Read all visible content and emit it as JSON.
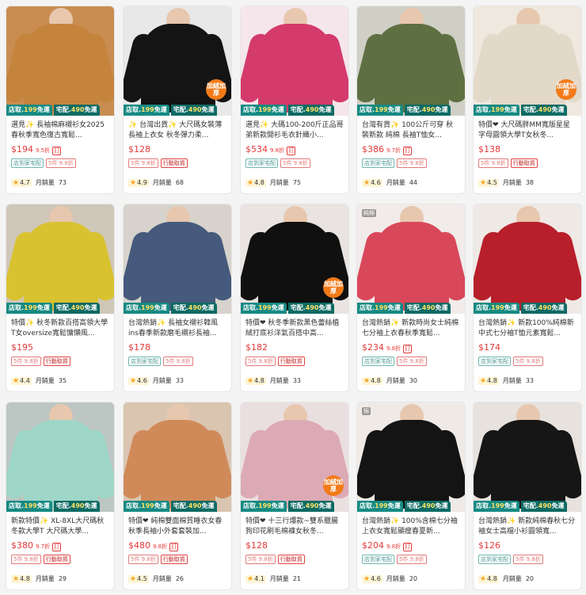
{
  "ribbon": {
    "store_prefix": "店取.",
    "store_price": "199",
    "store_suffix": "免運",
    "home_prefix": "宅配.",
    "home_price": "490",
    "home_suffix": "免運"
  },
  "sold_label": "月銷量",
  "products": [
    {
      "title": "選見✨ 長袖棉麻襯衫女2025春秋季寬色復古寬鬆...",
      "price": "$194",
      "disc": "9.5折",
      "tix": "訂",
      "badges": [
        "店到家宅配",
        "5件 9.8折"
      ],
      "rating": "4.7",
      "sold": "73",
      "bg": "#c98d52",
      "cloth": "#c4843c",
      "corner": "",
      "warm": ""
    },
    {
      "title": "✨ 台灣出貨✨ 大尺碼女裝薄長袖上衣女 秋冬彈力柔...",
      "price": "$128",
      "disc": "",
      "tix": "",
      "badges": [
        "5件 9.8折",
        "行動取貨"
      ],
      "rating": "4.9",
      "sold": "68",
      "bg": "#e8e8e8",
      "cloth": "#141414",
      "corner": "",
      "warm": "加絨加厚"
    },
    {
      "title": "選見✨ 大碼100-200斤正品哥弟新款開衫毛衣針織小...",
      "price": "$534",
      "disc": "9.8折",
      "tix": "訂",
      "badges": [
        "店到家宅配",
        "5件 9.8折"
      ],
      "rating": "4.8",
      "sold": "75",
      "bg": "#f4e6ea",
      "cloth": "#d53a6c",
      "corner": "",
      "warm": ""
    },
    {
      "title": "台灣有貨✨ 100公斤可穿 秋裝新款 純棉 長袖T恤女...",
      "price": "$386",
      "disc": "9.7折",
      "tix": "訂",
      "badges": [
        "店到家宅配",
        "5件 9.8折"
      ],
      "rating": "4.6",
      "sold": "44",
      "bg": "#cfcfc5",
      "cloth": "#5e7042",
      "corner": "",
      "warm": ""
    },
    {
      "title": "特價❤ 大尺碼胖MM寬版星星字母圓領大學T女秋冬...",
      "price": "$138",
      "disc": "",
      "tix": "",
      "badges": [
        "5件 9.8折",
        "行動取貨"
      ],
      "rating": "4.5",
      "sold": "38",
      "bg": "#efe8df",
      "cloth": "#e3d9c9",
      "corner": "",
      "warm": "加絨加厚"
    },
    {
      "title": "特價✨ 秋冬新款百搭高領大學T女oversize寬鬆慵懶風...",
      "price": "$195",
      "disc": "",
      "tix": "",
      "badges": [
        "5件 9.8折",
        "行動取貨"
      ],
      "rating": "4.4",
      "sold": "35",
      "bg": "#cfc7b8",
      "cloth": "#d9c230",
      "corner": "",
      "warm": ""
    },
    {
      "title": "台灣熱銷✨ 長袖女襯衫韓風ins春季新款磨毛襯衫長袖...",
      "price": "$178",
      "disc": "",
      "tix": "",
      "badges": [
        "店到家宅配",
        "5件 9.8折"
      ],
      "rating": "4.6",
      "sold": "33",
      "bg": "#d7d3cc",
      "cloth": "#455a7c",
      "corner": "",
      "warm": ""
    },
    {
      "title": "特價❤ 秋冬季新款黑色蕾絲植絨打底衫洋氣百搭中高...",
      "price": "$182",
      "disc": "",
      "tix": "",
      "badges": [
        "5件 9.8折",
        "行動取貨"
      ],
      "rating": "4.8",
      "sold": "33",
      "bg": "#e9e4e1",
      "cloth": "#101010",
      "corner": "",
      "warm": "加絨加厚"
    },
    {
      "title": "台灣熱銷✨ 新款時尚女士純棉七分袖上衣春秋季寬鬆...",
      "price": "$234",
      "disc": "9.8折",
      "tix": "訂",
      "badges": [
        "店到家宅配",
        "5件 9.8折"
      ],
      "rating": "4.8",
      "sold": "30",
      "bg": "#f1ecea",
      "cloth": "#d9485a",
      "corner": "純棉",
      "warm": ""
    },
    {
      "title": "台灣熱銷✨ 新款100%純棉新中式七分袖T恤元素寬鬆...",
      "price": "$174",
      "disc": "",
      "tix": "",
      "badges": [
        "店到家宅配",
        "5件 9.8折"
      ],
      "rating": "4.8",
      "sold": "33",
      "bg": "#efe9e6",
      "cloth": "#b81f2b",
      "corner": "",
      "warm": ""
    },
    {
      "title": "新款特價✨ XL-8XL大尺碼秋冬款大學T 大尺碼大學...",
      "price": "$380",
      "disc": "9.7折",
      "tix": "訂",
      "badges": [
        "5件 9.8折",
        "行動取貨"
      ],
      "rating": "4.8",
      "sold": "29",
      "bg": "#bcc6c2",
      "cloth": "#9ed6c8",
      "corner": "",
      "warm": ""
    },
    {
      "title": "特價❤ 純棉雙面棉質睡衣女春秋季長袖小外套套裝加...",
      "price": "$480",
      "disc": "9.8折",
      "tix": "訂",
      "badges": [
        "5件 9.8折",
        "行動取貨"
      ],
      "rating": "4.5",
      "sold": "26",
      "bg": "#d9c5b0",
      "cloth": "#d08a5a",
      "corner": "",
      "warm": ""
    },
    {
      "title": "特價❤ 十三行爆款~雙系臘腸狗印花刷毛棉褲女秋冬...",
      "price": "$128",
      "disc": "",
      "tix": "",
      "badges": [
        "5件 9.8折",
        "行動取貨"
      ],
      "rating": "4.1",
      "sold": "21",
      "bg": "#eadfe0",
      "cloth": "#dcaab4",
      "corner": "",
      "warm": "加絨加厚"
    },
    {
      "title": "台灣熱銷✨ 100%含棉七分袖上衣女寬鬆顯瘦春夏新...",
      "price": "$204",
      "disc": "9.8折",
      "tix": "訂",
      "badges": [
        "店到家宅配",
        "5件 9.8折"
      ],
      "rating": "4.6",
      "sold": "20",
      "bg": "#efeae6",
      "cloth": "#141414",
      "corner": "棉",
      "warm": ""
    },
    {
      "title": "台灣熱銷✨ 新款純棉春秋七分袖女士高檔小衫圓領寬...",
      "price": "$126",
      "disc": "",
      "tix": "",
      "badges": [
        "店到家宅配",
        "5件 9.8折"
      ],
      "rating": "4.8",
      "sold": "20",
      "bg": "#e7e2dd",
      "cloth": "#161616",
      "corner": "",
      "warm": ""
    }
  ]
}
